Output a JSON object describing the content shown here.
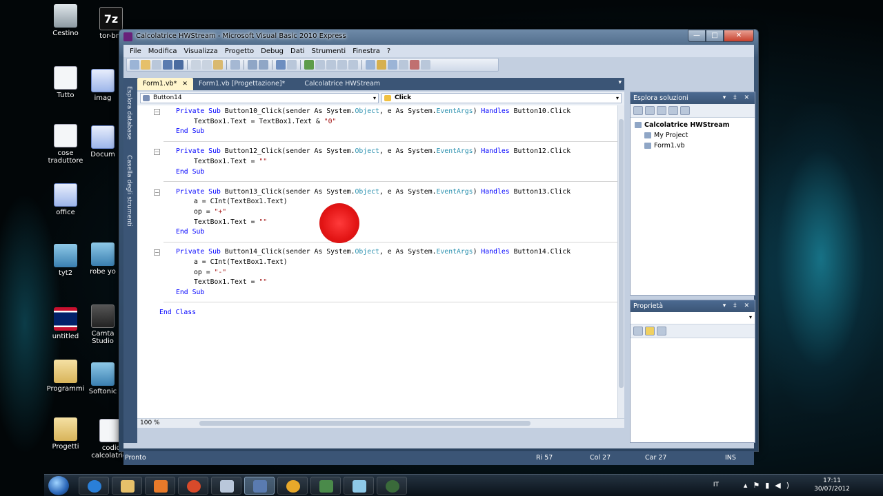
{
  "desktop": {
    "icons": [
      {
        "label": "Cestino",
        "icon": "recycle-bin-icon"
      },
      {
        "label": "tor-bro",
        "icon": "7zip-archive-icon"
      },
      {
        "label": "Tutto",
        "icon": "document-icon"
      },
      {
        "label": "imag",
        "icon": "word-doc-icon"
      },
      {
        "label": "cose traduttore",
        "icon": "document-icon"
      },
      {
        "label": "Docum",
        "icon": "word-doc-icon"
      },
      {
        "label": "office",
        "icon": "word-doc-icon"
      },
      {
        "label": "tyt2",
        "icon": "app-icon"
      },
      {
        "label": "robe yo",
        "icon": "app-icon"
      },
      {
        "label": "untitled",
        "icon": "uk-flag-icon"
      },
      {
        "label": "Camta Studio",
        "icon": "camtasia-icon"
      },
      {
        "label": "Programmi",
        "icon": "folder-icon"
      },
      {
        "label": "Softonic",
        "icon": "app-icon"
      },
      {
        "label": "Progetti",
        "icon": "folder-icon"
      },
      {
        "label": "codic calcolatrice",
        "icon": "document-icon"
      }
    ]
  },
  "window": {
    "title": "Calcolatrice HWStream - Microsoft Visual Basic 2010 Express",
    "min": "—",
    "max": "□",
    "close": "✕"
  },
  "menu": [
    "File",
    "Modifica",
    "Visualizza",
    "Progetto",
    "Debug",
    "Dati",
    "Strumenti",
    "Finestra",
    "?"
  ],
  "tabs": [
    {
      "label": "Form1.vb*",
      "close": "✕",
      "active": true
    },
    {
      "label": "Form1.vb [Progettazione]*",
      "active": false
    },
    {
      "label": "Calcolatrice HWStream",
      "active": false
    }
  ],
  "sidebar_tabs": [
    "Esplora database",
    "Casella degli strumenti"
  ],
  "combos": {
    "object": "Button14",
    "event": "Click"
  },
  "code": {
    "zoom": "100 %",
    "lines": [
      {
        "kind": "sub",
        "text": "Button10_Click(sender As System.",
        "mid": ", e As System.",
        "end": ") Handles Button10.Click"
      },
      {
        "kind": "body",
        "text": "TextBox1.Text = TextBox1.Text & ",
        "str": "\"0\""
      },
      {
        "kind": "endsub"
      },
      {
        "kind": "sub",
        "text": "Button12_Click(sender As System.",
        "mid": ", e As System.",
        "end": ") Handles Button12.Click"
      },
      {
        "kind": "body",
        "text": "TextBox1.Text = ",
        "str": "\"\""
      },
      {
        "kind": "endsub"
      },
      {
        "kind": "sub",
        "text": "Button13_Click(sender As System.",
        "mid": ", e As System.",
        "end": ") Handles Button13.Click"
      },
      {
        "kind": "body",
        "text": "a = CInt(TextBox1.Text)"
      },
      {
        "kind": "body",
        "text": "op = ",
        "str": "\"+\""
      },
      {
        "kind": "body",
        "text": "TextBox1.Text = ",
        "str": "\"\""
      },
      {
        "kind": "endsub"
      },
      {
        "kind": "sub",
        "text": "Button14_Click(sender As System.",
        "mid": ", e As System.",
        "end": ") Handles Button14.Click"
      },
      {
        "kind": "body",
        "text": "a = CInt(TextBox1.Text)"
      },
      {
        "kind": "body",
        "text": "op = ",
        "str": "\"-\""
      },
      {
        "kind": "body",
        "text": "TextBox1.Text = ",
        "str": "\"\""
      },
      {
        "kind": "endsub"
      },
      {
        "kind": "endclass"
      }
    ],
    "kw": {
      "private": "Private",
      "sub": "Sub",
      "as": "As",
      "handles": "Handles",
      "end": "End",
      "class": "Class",
      "object": "Object",
      "eventargs": "EventArgs"
    }
  },
  "solution_explorer": {
    "title": "Esplora soluzioni",
    "root": "Calcolatrice HWStream",
    "items": [
      "My Project",
      "Form1.vb"
    ]
  },
  "properties": {
    "title": "Proprietà"
  },
  "panel_buttons": "▾ ‡ ✕",
  "statusbar": {
    "state": "Pronto",
    "row": "Ri 57",
    "col": "Col 27",
    "car": "Car 27",
    "mode": "INS"
  },
  "taskbar": {
    "lang": "IT",
    "time": "17:11",
    "date": "30/07/2012"
  }
}
